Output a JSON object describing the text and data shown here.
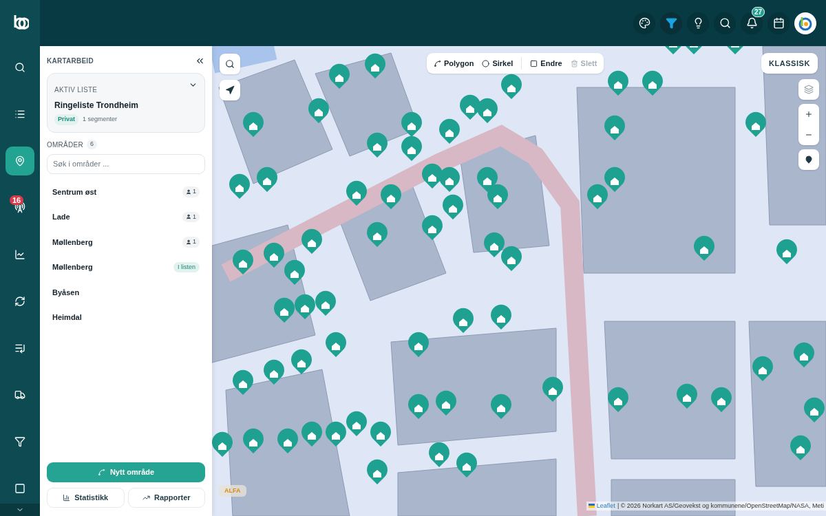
{
  "topbar": {
    "actions": [
      {
        "selected": false
      },
      {
        "selected": true
      },
      {
        "selected": false
      },
      {
        "selected": false
      },
      {
        "selected": false,
        "badge": "27"
      },
      {
        "selected": false
      }
    ]
  },
  "rail": {
    "items": [
      {
        "selected": false
      },
      {
        "selected": false
      },
      {
        "selected": true
      },
      {
        "selected": false,
        "badge": "16"
      },
      {
        "selected": false
      },
      {
        "selected": false
      },
      {
        "selected": false
      },
      {
        "selected": false
      },
      {
        "selected": false
      },
      {
        "selected": false
      }
    ]
  },
  "panel": {
    "title": "KARTARBEID",
    "active_list": {
      "label": "AKTIV LISTE",
      "name": "Ringeliste Trondheim",
      "tag": "Privat",
      "segments": "1 segmenter"
    },
    "areas_label": "OMRÅDER",
    "areas_count": "6",
    "search": {
      "placeholder": "Søk i områder ..."
    },
    "areas": [
      {
        "name": "Sentrum øst",
        "kind": "count",
        "badge": "1"
      },
      {
        "name": "Lade",
        "kind": "count",
        "badge": "1"
      },
      {
        "name": "Møllenberg",
        "kind": "count",
        "badge": "1"
      },
      {
        "name": "Møllenberg",
        "kind": "tag",
        "badge": "I listen"
      },
      {
        "name": "Byåsen",
        "kind": "none"
      },
      {
        "name": "Heimdal",
        "kind": "none"
      }
    ],
    "new_button": "Nytt område",
    "buttons": [
      "Statistikk",
      "Rapporter"
    ]
  },
  "map": {
    "tools": [
      {
        "label": "Polygon",
        "disabled": false
      },
      {
        "label": "Sirkel",
        "disabled": false
      },
      {
        "label": "Endre",
        "disabled": false
      },
      {
        "label": "Slett",
        "disabled": true
      }
    ],
    "style_button": "KLASSISK",
    "env_badge": "ALFA",
    "attribution_link": "Leaflet",
    "attribution": "| © 2026 Norkart AS/Geovekst og kommunene/OpenStreetMap/NASA, Meti"
  }
}
